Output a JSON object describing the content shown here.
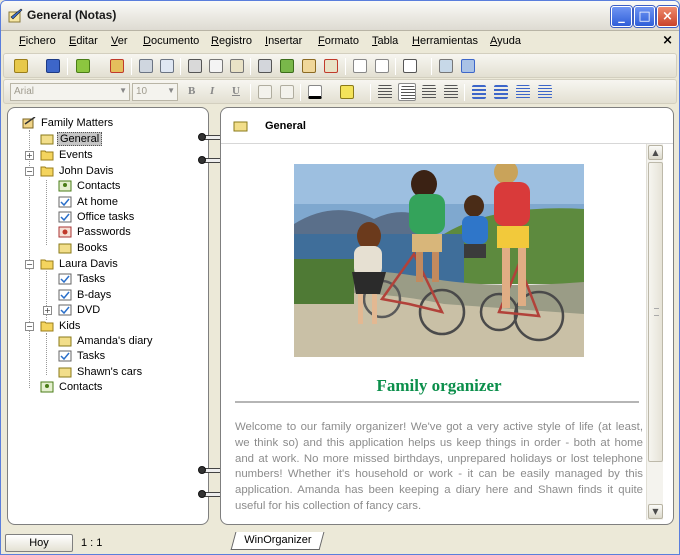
{
  "window": {
    "title": "General (Notas)",
    "accent_color": "#2f5ed8",
    "close_color": "#c9432a"
  },
  "menubar": {
    "items": [
      "Fichero",
      "Editar",
      "Ver",
      "Documento",
      "Registro",
      "Insertar",
      "Formato",
      "Tabla",
      "Herramientas",
      "Ayuda"
    ],
    "close_glyph": "×"
  },
  "format_toolbar": {
    "font_name": "Arial",
    "font_size": "10",
    "bold_label": "B",
    "italic_label": "I",
    "underline_label": "U"
  },
  "tree": {
    "items": [
      {
        "label": "Family Matters",
        "icon": "notebook-icon"
      },
      {
        "label": "General",
        "icon": "note-icon"
      },
      {
        "label": "Events",
        "icon": "folder-icon"
      },
      {
        "label": "John Davis",
        "icon": "folder-icon"
      },
      {
        "label": "Contacts",
        "icon": "contacts-icon"
      },
      {
        "label": "At home",
        "icon": "checklist-icon"
      },
      {
        "label": "Office tasks",
        "icon": "checklist-icon"
      },
      {
        "label": "Passwords",
        "icon": "passwords-icon"
      },
      {
        "label": "Books",
        "icon": "note-icon"
      },
      {
        "label": "Laura Davis",
        "icon": "folder-icon"
      },
      {
        "label": "Tasks",
        "icon": "checklist-icon"
      },
      {
        "label": "B-days",
        "icon": "checklist-icon"
      },
      {
        "label": "DVD",
        "icon": "checklist-icon"
      },
      {
        "label": "Kids",
        "icon": "folder-icon"
      },
      {
        "label": "Amanda's diary",
        "icon": "note-icon"
      },
      {
        "label": "Tasks",
        "icon": "checklist-icon"
      },
      {
        "label": "Shawn's cars",
        "icon": "note-icon"
      },
      {
        "label": "Contacts",
        "icon": "contacts-icon"
      }
    ],
    "selected_index": 1
  },
  "document": {
    "header_title": "General",
    "heading": "Family organizer",
    "heading_color": "#0b8f4b",
    "body": "Welcome to our family organizer! We've got a very active style of life (at least, we think so) and this application helps us keep things in order - both at home and at work. No more missed birthdays, unprepared holidays or lost telephone numbers! Whether it's household or work - it can be easily managed by this application. Amanda has been keeping a diary here and Shawn finds it quite useful for his collection of fancy cars."
  },
  "bottom_tab": {
    "label": "WinOrganizer"
  },
  "statusbar": {
    "today_button": "Hoy",
    "position": "1 : 1"
  }
}
